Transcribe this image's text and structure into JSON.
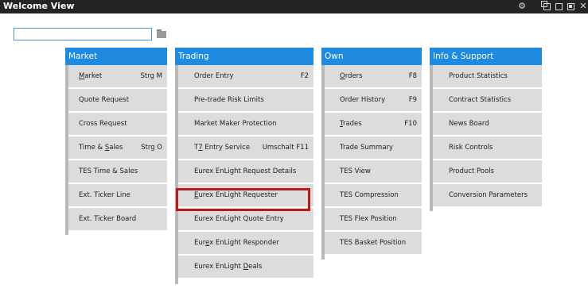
{
  "window": {
    "title": "Welcome View"
  },
  "colors": {
    "titlebar": "#242424",
    "header": "#1e8ae0",
    "item_bg": "#dcdcdc",
    "highlight": "#b51b1b"
  },
  "titlebar_icons": [
    "gear-icon",
    "window-restore-icon",
    "window-tile-icon",
    "save-icon",
    "close-icon"
  ],
  "search": {
    "value": "",
    "placeholder": ""
  },
  "columns": [
    {
      "header": "Market",
      "items": [
        {
          "label": "Market",
          "shortcut": "Strg M"
        },
        {
          "label": "Quote Request",
          "shortcut": ""
        },
        {
          "label": "Cross Request",
          "shortcut": ""
        },
        {
          "label": "Time & Sales",
          "shortcut": "Strg O"
        },
        {
          "label": "TES Time & Sales",
          "shortcut": ""
        },
        {
          "label": "Ext. Ticker Line",
          "shortcut": ""
        },
        {
          "label": "Ext. Ticker Board",
          "shortcut": ""
        }
      ]
    },
    {
      "header": "Trading",
      "items": [
        {
          "label": "Order Entry",
          "shortcut": "F2"
        },
        {
          "label": "Pre-trade Risk Limits",
          "shortcut": ""
        },
        {
          "label": "Market Maker Protection",
          "shortcut": ""
        },
        {
          "label": "T7 Entry Service",
          "shortcut": "Umschalt F11"
        },
        {
          "label": "Eurex EnLight Request Details",
          "shortcut": ""
        },
        {
          "label": "Eurex EnLight Requester",
          "shortcut": "",
          "highlighted": true
        },
        {
          "label": "Eurex EnLight Quote Entry",
          "shortcut": ""
        },
        {
          "label": "Eurex EnLight Responder",
          "shortcut": ""
        },
        {
          "label": "Eurex EnLight Deals",
          "shortcut": ""
        }
      ]
    },
    {
      "header": "Own",
      "items": [
        {
          "label": "Orders",
          "shortcut": "F8"
        },
        {
          "label": "Order History",
          "shortcut": "F9"
        },
        {
          "label": "Trades",
          "shortcut": "F10"
        },
        {
          "label": "Trade Summary",
          "shortcut": ""
        },
        {
          "label": "TES View",
          "shortcut": ""
        },
        {
          "label": "TES Compression",
          "shortcut": ""
        },
        {
          "label": "TES Flex Position",
          "shortcut": ""
        },
        {
          "label": "TES Basket Position",
          "shortcut": ""
        }
      ]
    },
    {
      "header": "Info & Support",
      "items": [
        {
          "label": "Product Statistics",
          "shortcut": ""
        },
        {
          "label": "Contract Statistics",
          "shortcut": ""
        },
        {
          "label": "News Board",
          "shortcut": ""
        },
        {
          "label": "Risk Controls",
          "shortcut": ""
        },
        {
          "label": "Product Pools",
          "shortcut": ""
        },
        {
          "label": "Conversion Parameters",
          "shortcut": ""
        }
      ]
    }
  ]
}
